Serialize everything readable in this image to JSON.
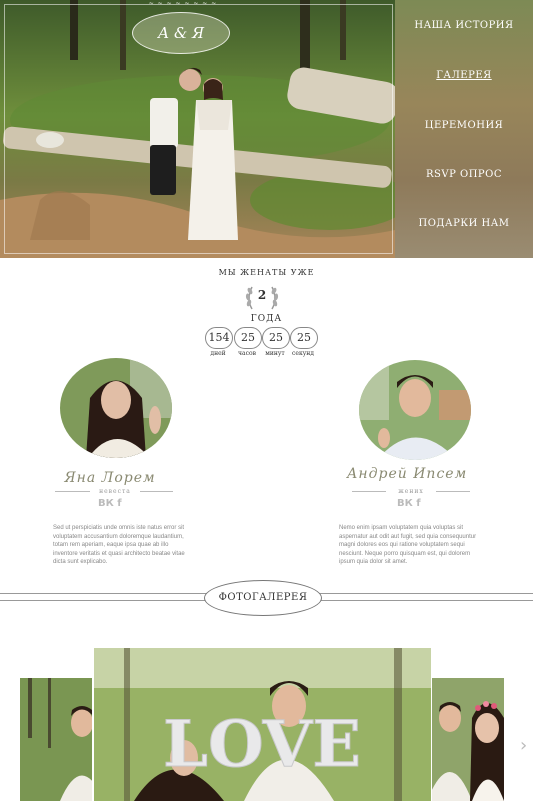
{
  "hero": {
    "monogram": "А & Я",
    "top_strip": "~ ~ ~ ~ ~ ~ ~ ~"
  },
  "nav": {
    "items": [
      {
        "label": "Наша история",
        "active": false
      },
      {
        "label": "Галерея",
        "active": true
      },
      {
        "label": "Церемония",
        "active": false
      },
      {
        "label": "RSVP опрос",
        "active": false
      },
      {
        "label": "Подарки нам",
        "active": false
      }
    ]
  },
  "counter": {
    "heading": "Мы женаты уже",
    "years": "2",
    "years_word": "года",
    "units": [
      {
        "value": "154",
        "label": "дней"
      },
      {
        "value": "25",
        "label": "часов"
      },
      {
        "value": "25",
        "label": "минут"
      },
      {
        "value": "25",
        "label": "секунд"
      }
    ]
  },
  "bride": {
    "name": "Яна Лорем",
    "role": "невеста",
    "social": "ВК f",
    "bio": "Sed ut perspiciatis unde omnis iste natus error sit voluptatem accusantium doloremque laudantium, totam rem aperiam, eaque ipsa quae ab illo inventore veritatis et quasi architecto beatae vitae dicta sunt explicabo."
  },
  "groom": {
    "name": "Андрей Ипсем",
    "role": "жених",
    "social": "ВК f",
    "bio": "Nemo enim ipsam voluptatem quia voluptas sit aspernatur aut odit aut fugit, sed quia consequuntur magni dolores eos qui ratione voluptatem sequi nesciunt. Neque porro quisquam est, qui dolorem ipsum quia dolor sit amet."
  },
  "gallery": {
    "title": "Фотогалерея",
    "love_word": "LOVE",
    "next_arrow": "›"
  },
  "colors": {
    "accent": "#8a8a72",
    "nav_text": "#ffffff",
    "rule": "#999999"
  }
}
